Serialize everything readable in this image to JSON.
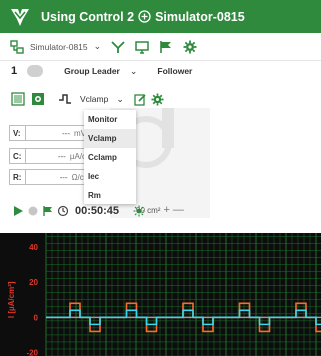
{
  "titlebar": {
    "title_left": "Using Control 2",
    "title_right": "Simulator-0815"
  },
  "toolbar": {
    "simulator_name": "Simulator-0815",
    "chevron": "⌄"
  },
  "group": {
    "number": "1",
    "leader_label": "Group Leader",
    "follower_label": "Follower",
    "chevron": "⌄"
  },
  "mode": {
    "selected": "Vclamp",
    "chevron": "⌄"
  },
  "readouts": [
    {
      "label": "V:",
      "value": "---",
      "unit": "mV"
    },
    {
      "label": "C:",
      "value": "---",
      "unit": "µA/c"
    },
    {
      "label": "R:",
      "value": "---",
      "unit": "Ω/cı"
    }
  ],
  "mode_menu": {
    "items": [
      "Monitor",
      "Vclamp",
      "Cclamp",
      "Iec",
      "Rm"
    ],
    "highlighted": "Vclamp"
  },
  "capacitance": {
    "value_text": "00 cm²",
    "plus": "+",
    "minus": "—"
  },
  "timer": {
    "elapsed": "00:50:45"
  },
  "chart_data": {
    "type": "line",
    "ylabel": "I [µA/cm²]",
    "y_ticks": [
      "40",
      "20",
      "0",
      "-20"
    ],
    "ylim": [
      -22,
      48
    ],
    "series": [
      {
        "color": "#ff6a2a",
        "pulse_high": 8,
        "pulse_low": -8
      },
      {
        "color": "#3ad6e8",
        "pulse_high": 4,
        "pulse_low": -4
      },
      {
        "color": "#9a9a9a",
        "baseline": 0
      }
    ],
    "colors": {
      "grid": "#1f7a2e",
      "axis_text": "#d9382a",
      "background": "#0d0d0d"
    }
  }
}
